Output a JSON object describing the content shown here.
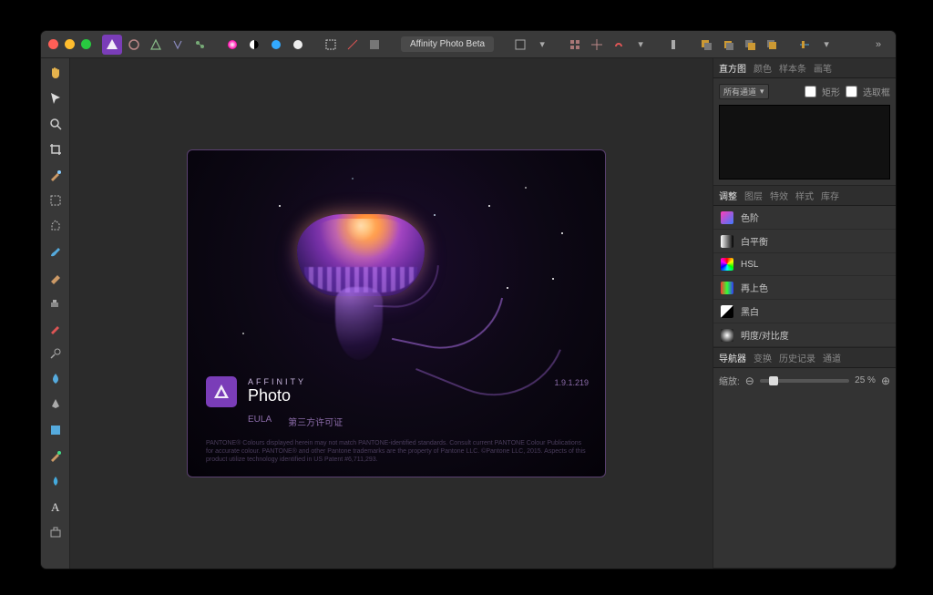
{
  "app": {
    "title": "Affinity Photo Beta"
  },
  "tool_names": [
    "hand-tool",
    "move-tool",
    "view-tool",
    "crop-tool",
    "selection-brush",
    "marquee-tool",
    "flood-select",
    "paint-brush",
    "erase-tool",
    "clone-tool",
    "inpaint-tool",
    "dodge-tool",
    "blur-tool",
    "pen-tool",
    "shape-tool",
    "gradient-tool",
    "color-picker",
    "text-tool",
    "export-persona"
  ],
  "splash": {
    "brand_line1": "AFFINITY",
    "brand_line2": "Photo",
    "version": "1.9.1.219",
    "eula": "EULA",
    "third_party": "第三方许可证",
    "legal": "PANTONE® Colours displayed herein may not match PANTONE-identified standards. Consult current PANTONE Colour Publications for accurate colour. PANTONE® and other Pantone trademarks are the property of Pantone LLC. ©Pantone LLC, 2015. Aspects of this product utilize technology identified in US Patent #6,711,293."
  },
  "panel_histogram": {
    "tabs": [
      "直方图",
      "颜色",
      "样本条",
      "画笔"
    ],
    "channels_label": "所有通道",
    "checkbox1": "矩形",
    "checkbox2": "选取框"
  },
  "panel_adjust": {
    "tabs": [
      "调整",
      "图层",
      "特效",
      "样式",
      "库存"
    ],
    "items": [
      {
        "name": "色阶",
        "sw": "linear-gradient(135deg,#ff3db8,#3d7aff)"
      },
      {
        "name": "白平衡",
        "sw": "linear-gradient(90deg,#fff,#000)"
      },
      {
        "name": "HSL",
        "sw": "conic-gradient(red,yellow,lime,cyan,blue,magenta,red)"
      },
      {
        "name": "再上色",
        "sw": "linear-gradient(90deg,#f33,#3f3,#33f)"
      },
      {
        "name": "黑白",
        "sw": "linear-gradient(135deg,#fff 49%,#000 51%)"
      },
      {
        "name": "明度/对比度",
        "sw": "radial-gradient(circle,#fff,#000)"
      }
    ]
  },
  "panel_nav": {
    "tabs": [
      "导航器",
      "变换",
      "历史记录",
      "通道"
    ],
    "zoom_label": "缩放:",
    "zoom_value": "25 %"
  }
}
